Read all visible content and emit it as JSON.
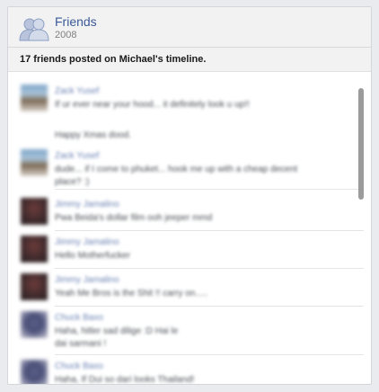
{
  "header": {
    "title": "Friends",
    "year": "2008",
    "icon": "friends-icon"
  },
  "summary": "17 friends posted on Michael's timeline.",
  "posts": [
    {
      "author": "Zack Yusef",
      "message": "If ur ever near your hood... it definitely look u up!!",
      "avatar": "photo"
    },
    {
      "author": "",
      "message": "Happy Xmas dood.",
      "avatar": ""
    },
    {
      "author": "Zack Yusef",
      "message": "dude... if I come to phuket... hook me up with a cheap decent place? :)",
      "avatar": "photo"
    },
    {
      "author": "Jimmy Jamalino",
      "message": "Pwa Beida's dollar film ooh jeeper mmd",
      "avatar": "dark"
    },
    {
      "author": "Jimmy Jamalino",
      "message": "Hello Motherfucker",
      "avatar": "dark"
    },
    {
      "author": "Jimmy Jamalino",
      "message": "Yeah Me Bros is the Shit !! carry on.....",
      "avatar": "dark"
    },
    {
      "author": "Chuck Baxo",
      "message": "Haha, hitler sad dilige :D Hai le dai sarmani !",
      "avatar": "purple"
    },
    {
      "author": "Chuck Baxo",
      "message": "Haha, If Dui so dari looks Thailand!",
      "avatar": "purple"
    }
  ],
  "colors": {
    "link": "#3b5998",
    "author": "#6d84b4",
    "header_bg": "#f2f2f2"
  }
}
